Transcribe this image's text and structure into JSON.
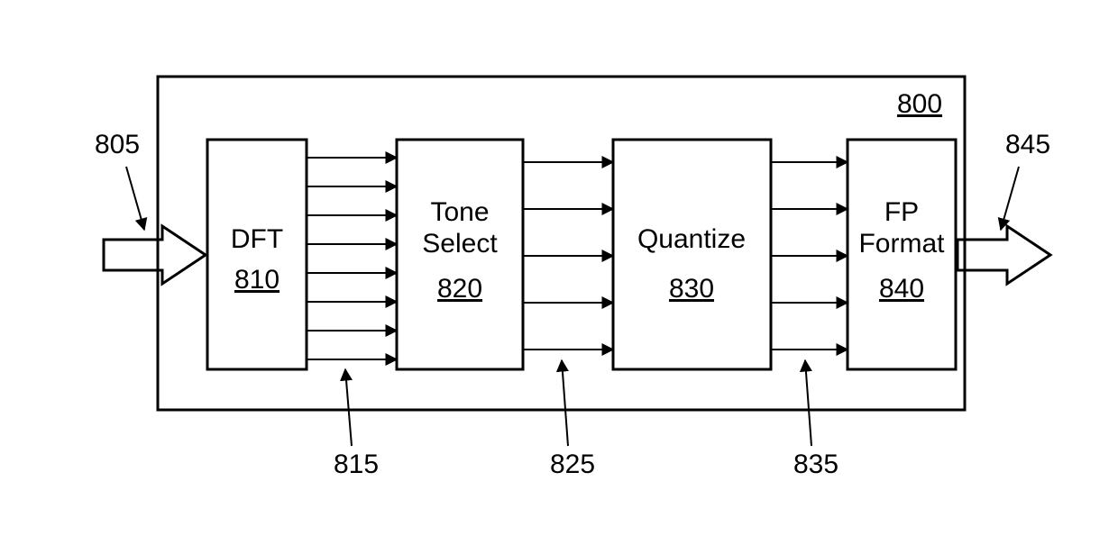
{
  "container_ref": "800",
  "input_ref": "805",
  "output_ref": "845",
  "blocks": {
    "dft": {
      "label": "DFT",
      "ref": "810"
    },
    "toneSelect": {
      "line1": "Tone",
      "line2": "Select",
      "ref": "820"
    },
    "quantize": {
      "label": "Quantize",
      "ref": "830"
    },
    "fpFormat": {
      "line1": "FP",
      "line2": "Format",
      "ref": "840"
    }
  },
  "bus_refs": {
    "a": "815",
    "b": "825",
    "c": "835"
  }
}
